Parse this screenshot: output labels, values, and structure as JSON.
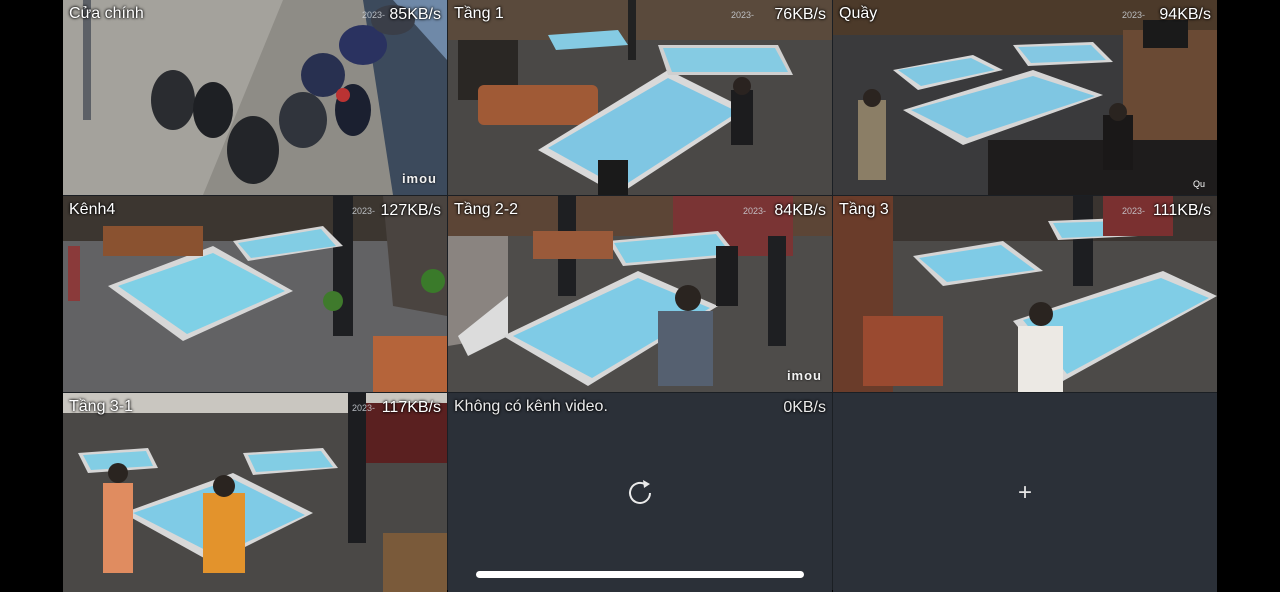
{
  "tiles": [
    {
      "name": "Cửa chính",
      "rate": "85KB/s",
      "stamp": "2023-",
      "watermark": "imou"
    },
    {
      "name": "Tầng 1",
      "rate": "76KB/s",
      "stamp": "2023-"
    },
    {
      "name": "Quầy",
      "rate": "94KB/s",
      "stamp": "2023-",
      "corner": "Qu"
    },
    {
      "name": "Kênh4",
      "rate": "127KB/s",
      "stamp": "2023-"
    },
    {
      "name": "Tầng 2-2",
      "rate": "84KB/s",
      "stamp": "2023-",
      "watermark": "imou"
    },
    {
      "name": "Tầng 3",
      "rate": "111KB/s",
      "stamp": "2023-"
    },
    {
      "name": "Tầng 3-1",
      "rate": "117KB/s",
      "stamp": "2023-"
    }
  ],
  "empty_channel": {
    "message": "Không có kênh video.",
    "rate": "0KB/s",
    "icon": "reload-icon"
  },
  "add_channel": {
    "label": "+",
    "icon": "plus-icon"
  },
  "colors": {
    "selected_border": "#3f6fd8",
    "table_felt": "#7fd2e6",
    "panel": "#2b3038"
  }
}
